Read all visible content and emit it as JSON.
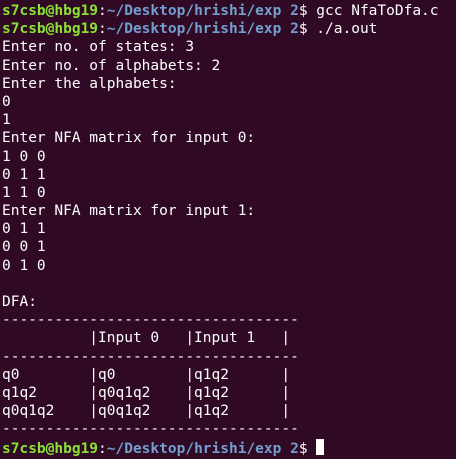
{
  "colors": {
    "background": "#300a24",
    "prompt_user": "#8ae234",
    "prompt_path": "#729fcf",
    "text": "#ffffff"
  },
  "prompt": {
    "user_host": "s7csb@hbg19",
    "colon": ":",
    "path": "~/Desktop/hrishi/exp 2",
    "symbol": "$ "
  },
  "commands": [
    "gcc NfaToDfa.c",
    "./a.out",
    ""
  ],
  "output": [
    "Enter no. of states: 3",
    "Enter no. of alphabets: 2",
    "Enter the alphabets:",
    "0",
    "1",
    "Enter NFA matrix for input 0:",
    "1 0 0",
    "0 1 1",
    "1 1 0",
    "Enter NFA matrix for input 1:",
    "0 1 1",
    "0 0 1",
    "0 1 0",
    "",
    "DFA:",
    "----------------------------------",
    "          |Input 0   |Input 1   |",
    "----------------------------------",
    "q0        |q0        |q1q2      |",
    "q1q2      |q0q1q2    |q1q2      |",
    "q0q1q2    |q0q1q2    |q1q2      |",
    "----------------------------------"
  ]
}
